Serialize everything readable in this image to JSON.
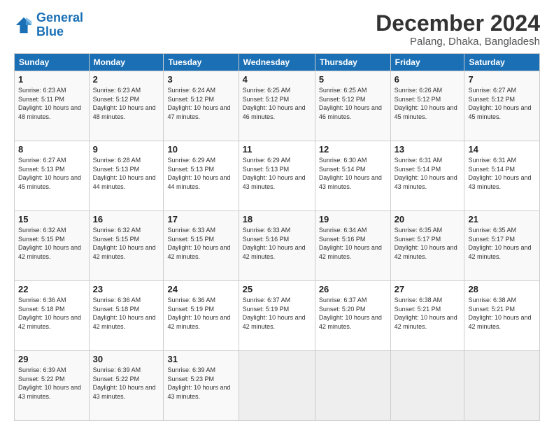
{
  "logo": {
    "line1": "General",
    "line2": "Blue"
  },
  "header": {
    "title": "December 2024",
    "subtitle": "Palang, Dhaka, Bangladesh"
  },
  "calendar": {
    "days_of_week": [
      "Sunday",
      "Monday",
      "Tuesday",
      "Wednesday",
      "Thursday",
      "Friday",
      "Saturday"
    ],
    "weeks": [
      [
        {
          "day": "",
          "empty": true
        },
        {
          "day": "",
          "empty": true
        },
        {
          "day": "",
          "empty": true
        },
        {
          "day": "",
          "empty": true
        },
        {
          "day": "",
          "empty": true
        },
        {
          "day": "",
          "empty": true
        },
        {
          "day": "",
          "empty": true
        }
      ],
      [
        {
          "day": "1",
          "sunrise": "6:23 AM",
          "sunset": "5:11 PM",
          "daylight": "10 hours and 48 minutes."
        },
        {
          "day": "2",
          "sunrise": "6:23 AM",
          "sunset": "5:12 PM",
          "daylight": "10 hours and 48 minutes."
        },
        {
          "day": "3",
          "sunrise": "6:24 AM",
          "sunset": "5:12 PM",
          "daylight": "10 hours and 47 minutes."
        },
        {
          "day": "4",
          "sunrise": "6:25 AM",
          "sunset": "5:12 PM",
          "daylight": "10 hours and 46 minutes."
        },
        {
          "day": "5",
          "sunrise": "6:25 AM",
          "sunset": "5:12 PM",
          "daylight": "10 hours and 46 minutes."
        },
        {
          "day": "6",
          "sunrise": "6:26 AM",
          "sunset": "5:12 PM",
          "daylight": "10 hours and 45 minutes."
        },
        {
          "day": "7",
          "sunrise": "6:27 AM",
          "sunset": "5:12 PM",
          "daylight": "10 hours and 45 minutes."
        }
      ],
      [
        {
          "day": "8",
          "sunrise": "6:27 AM",
          "sunset": "5:13 PM",
          "daylight": "10 hours and 45 minutes."
        },
        {
          "day": "9",
          "sunrise": "6:28 AM",
          "sunset": "5:13 PM",
          "daylight": "10 hours and 44 minutes."
        },
        {
          "day": "10",
          "sunrise": "6:29 AM",
          "sunset": "5:13 PM",
          "daylight": "10 hours and 44 minutes."
        },
        {
          "day": "11",
          "sunrise": "6:29 AM",
          "sunset": "5:13 PM",
          "daylight": "10 hours and 43 minutes."
        },
        {
          "day": "12",
          "sunrise": "6:30 AM",
          "sunset": "5:14 PM",
          "daylight": "10 hours and 43 minutes."
        },
        {
          "day": "13",
          "sunrise": "6:31 AM",
          "sunset": "5:14 PM",
          "daylight": "10 hours and 43 minutes."
        },
        {
          "day": "14",
          "sunrise": "6:31 AM",
          "sunset": "5:14 PM",
          "daylight": "10 hours and 43 minutes."
        }
      ],
      [
        {
          "day": "15",
          "sunrise": "6:32 AM",
          "sunset": "5:15 PM",
          "daylight": "10 hours and 42 minutes."
        },
        {
          "day": "16",
          "sunrise": "6:32 AM",
          "sunset": "5:15 PM",
          "daylight": "10 hours and 42 minutes."
        },
        {
          "day": "17",
          "sunrise": "6:33 AM",
          "sunset": "5:15 PM",
          "daylight": "10 hours and 42 minutes."
        },
        {
          "day": "18",
          "sunrise": "6:33 AM",
          "sunset": "5:16 PM",
          "daylight": "10 hours and 42 minutes."
        },
        {
          "day": "19",
          "sunrise": "6:34 AM",
          "sunset": "5:16 PM",
          "daylight": "10 hours and 42 minutes."
        },
        {
          "day": "20",
          "sunrise": "6:35 AM",
          "sunset": "5:17 PM",
          "daylight": "10 hours and 42 minutes."
        },
        {
          "day": "21",
          "sunrise": "6:35 AM",
          "sunset": "5:17 PM",
          "daylight": "10 hours and 42 minutes."
        }
      ],
      [
        {
          "day": "22",
          "sunrise": "6:36 AM",
          "sunset": "5:18 PM",
          "daylight": "10 hours and 42 minutes."
        },
        {
          "day": "23",
          "sunrise": "6:36 AM",
          "sunset": "5:18 PM",
          "daylight": "10 hours and 42 minutes."
        },
        {
          "day": "24",
          "sunrise": "6:36 AM",
          "sunset": "5:19 PM",
          "daylight": "10 hours and 42 minutes."
        },
        {
          "day": "25",
          "sunrise": "6:37 AM",
          "sunset": "5:19 PM",
          "daylight": "10 hours and 42 minutes."
        },
        {
          "day": "26",
          "sunrise": "6:37 AM",
          "sunset": "5:20 PM",
          "daylight": "10 hours and 42 minutes."
        },
        {
          "day": "27",
          "sunrise": "6:38 AM",
          "sunset": "5:21 PM",
          "daylight": "10 hours and 42 minutes."
        },
        {
          "day": "28",
          "sunrise": "6:38 AM",
          "sunset": "5:21 PM",
          "daylight": "10 hours and 42 minutes."
        }
      ],
      [
        {
          "day": "29",
          "sunrise": "6:39 AM",
          "sunset": "5:22 PM",
          "daylight": "10 hours and 43 minutes."
        },
        {
          "day": "30",
          "sunrise": "6:39 AM",
          "sunset": "5:22 PM",
          "daylight": "10 hours and 43 minutes."
        },
        {
          "day": "31",
          "sunrise": "6:39 AM",
          "sunset": "5:23 PM",
          "daylight": "10 hours and 43 minutes."
        },
        {
          "day": "",
          "empty": true
        },
        {
          "day": "",
          "empty": true
        },
        {
          "day": "",
          "empty": true
        },
        {
          "day": "",
          "empty": true
        }
      ]
    ]
  }
}
